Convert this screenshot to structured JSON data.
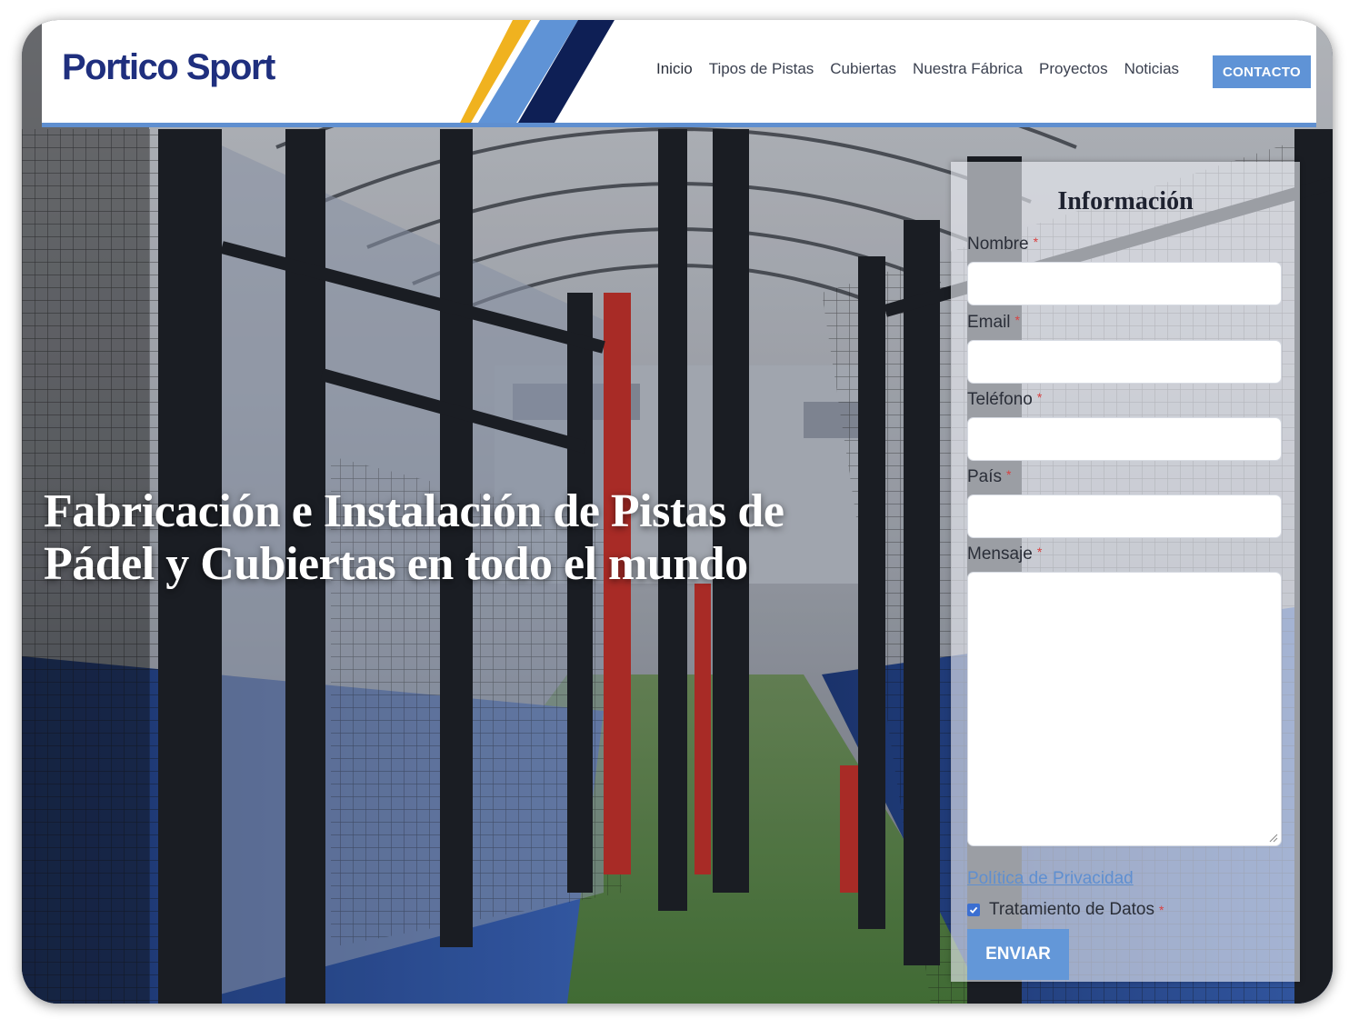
{
  "brand": {
    "name": "Portico Sport"
  },
  "nav": {
    "items": [
      {
        "label": "Inicio"
      },
      {
        "label": "Tipos de Pistas"
      },
      {
        "label": "Cubiertas"
      },
      {
        "label": "Nuestra Fábrica"
      },
      {
        "label": "Proyectos"
      },
      {
        "label": "Noticias"
      }
    ],
    "contact_label": "CONTACTO"
  },
  "hero": {
    "headline": "Fabricación e Instalación de Pistas de Pádel y Cubiertas en todo el mundo"
  },
  "form": {
    "title": "Información",
    "fields": {
      "nombre": {
        "label": "Nombre",
        "value": ""
      },
      "email": {
        "label": "Email",
        "value": ""
      },
      "telefono": {
        "label": "Teléfono",
        "value": ""
      },
      "pais": {
        "label": "País",
        "value": ""
      },
      "mensaje": {
        "label": "Mensaje",
        "value": ""
      }
    },
    "required_mark": "*",
    "privacy_link": "Política de Privacidad",
    "consent_label": "Tratamiento de Datos",
    "consent_checked": true,
    "submit_label": "ENVIAR"
  },
  "colors": {
    "accent": "#5f8fd0",
    "brand_navy": "#1f2f7e",
    "button": "#6397d8",
    "required": "#d94040"
  }
}
